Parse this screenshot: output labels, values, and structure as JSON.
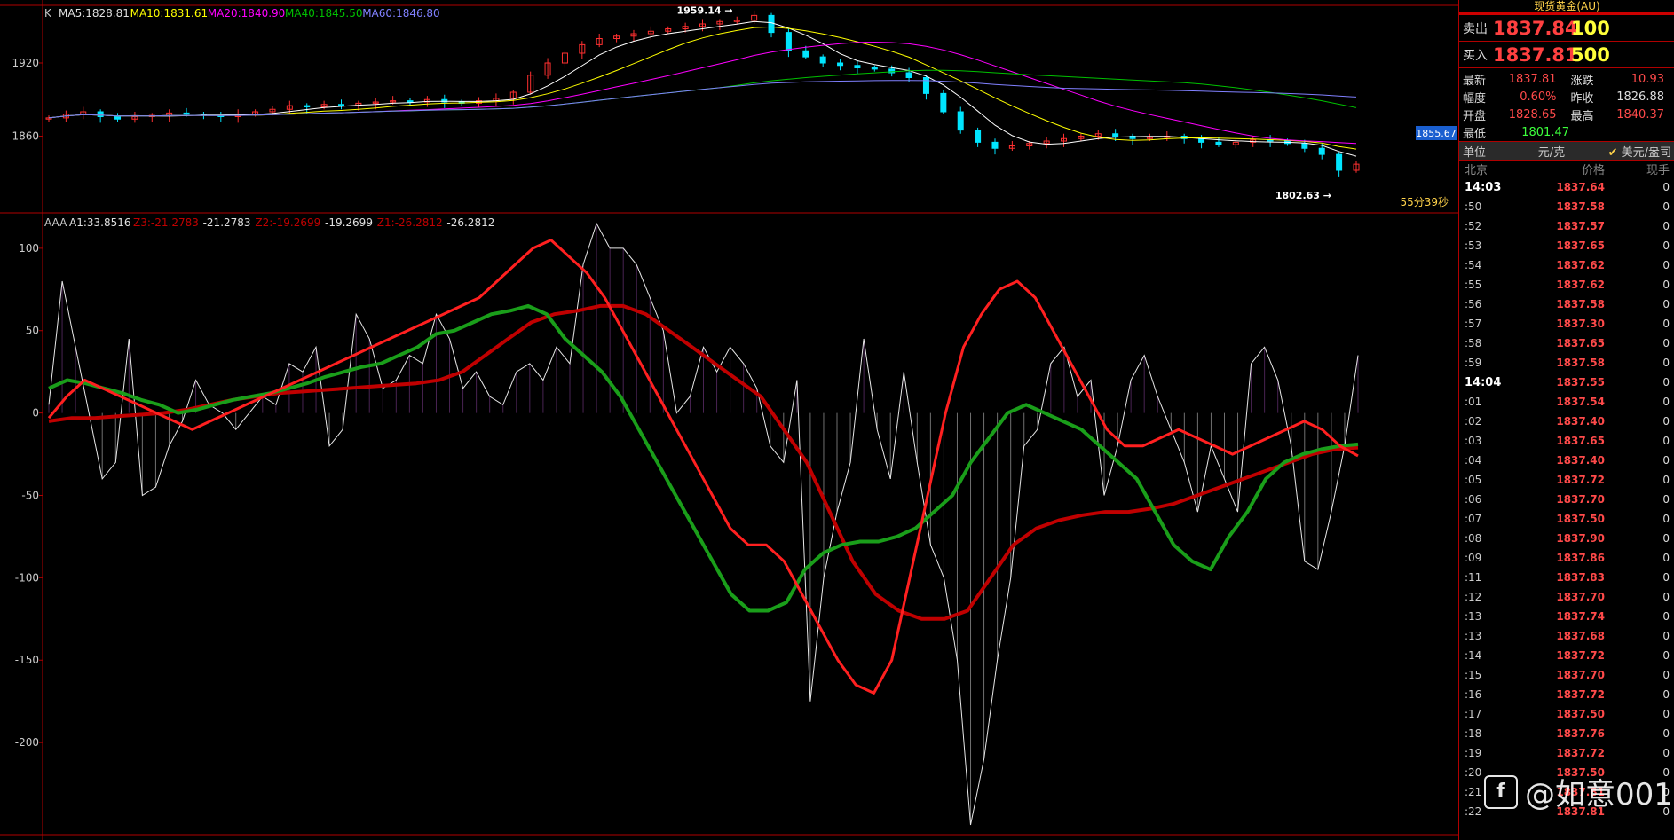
{
  "colors": {
    "up": "#ff3030",
    "down": "#00e5ff",
    "ma5": "#ffffff",
    "ma10": "#ffff00",
    "ma20": "#ff00ff",
    "ma40": "#00c000",
    "ma60": "#8080ff",
    "grid": "#b00000"
  },
  "panel_top": {
    "indicator_label": "K",
    "ma_labels": [
      {
        "text": "MA5:1828.81",
        "color": "#e0e0e0"
      },
      {
        "text": "MA10:1831.61",
        "color": "#ffff00"
      },
      {
        "text": "MA20:1840.90",
        "color": "#ff00ff"
      },
      {
        "text": "MA40:1845.50",
        "color": "#00c000"
      },
      {
        "text": "MA60:1846.80",
        "color": "#8080ff"
      }
    ],
    "high_marker": "1959.14",
    "low_marker": "1802.63",
    "current_price_tag": "1855.67",
    "countdown": "55分39秒",
    "yticks": [
      "1920",
      "1860"
    ]
  },
  "panel_bottom": {
    "indicator_label": "AAA",
    "readouts": [
      {
        "text": "A1:33.8516",
        "color": "#e0e0e0"
      },
      {
        "text": "Z3:-21.2783",
        "color": "#c00000"
      },
      {
        "text": "-21.2783",
        "color": "#e0e0e0"
      },
      {
        "text": "Z2:-19.2699",
        "color": "#c00000"
      },
      {
        "text": "-19.2699",
        "color": "#e0e0e0"
      },
      {
        "text": "Z1:-26.2812",
        "color": "#c00000"
      },
      {
        "text": "-26.2812",
        "color": "#e0e0e0"
      }
    ],
    "yticks": [
      "100",
      "50",
      "0",
      "-50",
      "-100",
      "-150",
      "-200"
    ]
  },
  "chart_data": {
    "type": "line",
    "top_price_range": [
      1800,
      1960
    ],
    "candles_approx_close": [
      1875,
      1878,
      1880,
      1876,
      1874,
      1876,
      1877,
      1879,
      1878,
      1877,
      1876,
      1878,
      1880,
      1882,
      1885,
      1884,
      1886,
      1885,
      1887,
      1888,
      1889,
      1888,
      1890,
      1888,
      1887,
      1889,
      1891,
      1896,
      1910,
      1920,
      1928,
      1935,
      1940,
      1942,
      1944,
      1946,
      1948,
      1950,
      1952,
      1954,
      1955,
      1959,
      1945,
      1930,
      1925,
      1920,
      1918,
      1916,
      1915,
      1912,
      1908,
      1895,
      1880,
      1865,
      1855,
      1850,
      1852,
      1854,
      1856,
      1858,
      1860,
      1862,
      1860,
      1858,
      1859,
      1860,
      1858,
      1855,
      1853,
      1855,
      1857,
      1856,
      1854,
      1850,
      1845,
      1832,
      1837
    ],
    "oscillator_range": [
      -250,
      115
    ],
    "A1": [
      5,
      80,
      40,
      0,
      -40,
      -30,
      45,
      -50,
      -45,
      -20,
      -5,
      20,
      5,
      0,
      -10,
      0,
      10,
      5,
      30,
      25,
      40,
      -20,
      -10,
      60,
      45,
      15,
      20,
      35,
      30,
      60,
      45,
      15,
      25,
      10,
      5,
      25,
      30,
      20,
      40,
      30,
      90,
      115,
      100,
      100,
      90,
      70,
      50,
      0,
      10,
      40,
      25,
      40,
      30,
      15,
      -20,
      -30,
      20,
      -175,
      -100,
      -60,
      -30,
      45,
      -10,
      -40,
      25,
      -30,
      -80,
      -100,
      -150,
      -250,
      -210,
      -150,
      -100,
      -20,
      -10,
      30,
      40,
      10,
      20,
      -50,
      -20,
      20,
      35,
      10,
      -10,
      -30,
      -60,
      -20,
      -40,
      -60,
      30,
      40,
      20,
      -20,
      -90,
      -95,
      -60,
      -20,
      35
    ],
    "Z1": [
      -3,
      10,
      20,
      15,
      10,
      5,
      0,
      -5,
      -10,
      -5,
      0,
      5,
      10,
      15,
      20,
      25,
      30,
      35,
      40,
      45,
      50,
      55,
      60,
      65,
      70,
      80,
      90,
      100,
      105,
      95,
      85,
      70,
      50,
      30,
      10,
      -10,
      -30,
      -50,
      -70,
      -80,
      -80,
      -90,
      -110,
      -130,
      -150,
      -165,
      -170,
      -150,
      -100,
      -50,
      0,
      40,
      60,
      75,
      80,
      70,
      50,
      30,
      10,
      -10,
      -20,
      -20,
      -15,
      -10,
      -15,
      -20,
      -25,
      -20,
      -15,
      -10,
      -5,
      -10,
      -20,
      -26
    ],
    "Z2": [
      15,
      20,
      18,
      15,
      12,
      8,
      5,
      0,
      2,
      5,
      8,
      10,
      12,
      15,
      18,
      22,
      25,
      28,
      30,
      35,
      40,
      48,
      50,
      55,
      60,
      62,
      65,
      60,
      45,
      35,
      25,
      10,
      -10,
      -30,
      -50,
      -70,
      -90,
      -110,
      -120,
      -120,
      -115,
      -95,
      -85,
      -80,
      -78,
      -78,
      -75,
      -70,
      -60,
      -50,
      -30,
      -15,
      0,
      5,
      0,
      -5,
      -10,
      -20,
      -30,
      -40,
      -60,
      -80,
      -90,
      -95,
      -75,
      -60,
      -40,
      -30,
      -25,
      -22,
      -20,
      -19
    ],
    "Z3": [
      -5,
      -3,
      -3,
      -2,
      -1,
      0,
      2,
      5,
      8,
      10,
      12,
      13,
      14,
      15,
      16,
      17,
      18,
      20,
      25,
      35,
      45,
      55,
      60,
      62,
      65,
      65,
      60,
      50,
      40,
      30,
      20,
      10,
      -10,
      -30,
      -60,
      -90,
      -110,
      -120,
      -125,
      -125,
      -120,
      -100,
      -80,
      -70,
      -65,
      -62,
      -60,
      -60,
      -58,
      -55,
      -50,
      -45,
      -40,
      -35,
      -30,
      -25,
      -22,
      -21
    ]
  },
  "sidebar": {
    "title": "现货黄金(AU)",
    "sell": {
      "label": "卖出",
      "price": "1837.84",
      "vol": "100"
    },
    "buy": {
      "label": "买入",
      "price": "1837.81",
      "vol": "500"
    },
    "stats": [
      [
        {
          "k": "最新",
          "v": "1837.81",
          "c": "#ff4a4a"
        },
        {
          "k": "涨跌",
          "v": "10.93",
          "c": "#ff4a4a"
        }
      ],
      [
        {
          "k": "幅度",
          "v": "0.60%",
          "c": "#ff4a4a"
        },
        {
          "k": "昨收",
          "v": "1826.88",
          "c": "#ddd"
        }
      ],
      [
        {
          "k": "开盘",
          "v": "1828.65",
          "c": "#ff4a4a"
        },
        {
          "k": "最高",
          "v": "1840.37",
          "c": "#ff4a4a"
        }
      ],
      [
        {
          "k": "最低",
          "v": "1801.47",
          "c": "#3cff3c"
        }
      ]
    ],
    "unit": {
      "label": "单位",
      "unit1": "元/克",
      "unit2": "美元/盎司"
    },
    "tick_header": {
      "time": "北京",
      "price": "价格",
      "vol": "现手"
    },
    "ticks": [
      {
        "t": "14:03",
        "p": "1837.64",
        "v": "0",
        "strong": true
      },
      {
        "t": ":50",
        "p": "1837.58",
        "v": "0"
      },
      {
        "t": ":52",
        "p": "1837.57",
        "v": "0"
      },
      {
        "t": ":53",
        "p": "1837.65",
        "v": "0"
      },
      {
        "t": ":54",
        "p": "1837.62",
        "v": "0"
      },
      {
        "t": ":55",
        "p": "1837.62",
        "v": "0"
      },
      {
        "t": ":56",
        "p": "1837.58",
        "v": "0"
      },
      {
        "t": ":57",
        "p": "1837.30",
        "v": "0"
      },
      {
        "t": ":58",
        "p": "1837.65",
        "v": "0"
      },
      {
        "t": ":59",
        "p": "1837.58",
        "v": "0"
      },
      {
        "t": "14:04",
        "p": "1837.55",
        "v": "0",
        "strong": true
      },
      {
        "t": ":01",
        "p": "1837.54",
        "v": "0"
      },
      {
        "t": ":02",
        "p": "1837.40",
        "v": "0"
      },
      {
        "t": ":03",
        "p": "1837.65",
        "v": "0"
      },
      {
        "t": ":04",
        "p": "1837.40",
        "v": "0"
      },
      {
        "t": ":05",
        "p": "1837.72",
        "v": "0"
      },
      {
        "t": ":06",
        "p": "1837.70",
        "v": "0"
      },
      {
        "t": ":07",
        "p": "1837.50",
        "v": "0"
      },
      {
        "t": ":08",
        "p": "1837.90",
        "v": "0"
      },
      {
        "t": ":09",
        "p": "1837.86",
        "v": "0"
      },
      {
        "t": ":11",
        "p": "1837.83",
        "v": "0"
      },
      {
        "t": ":12",
        "p": "1837.70",
        "v": "0"
      },
      {
        "t": ":13",
        "p": "1837.74",
        "v": "0"
      },
      {
        "t": ":13",
        "p": "1837.68",
        "v": "0"
      },
      {
        "t": ":14",
        "p": "1837.72",
        "v": "0"
      },
      {
        "t": ":15",
        "p": "1837.70",
        "v": "0"
      },
      {
        "t": ":16",
        "p": "1837.72",
        "v": "0"
      },
      {
        "t": ":17",
        "p": "1837.50",
        "v": "0"
      },
      {
        "t": ":18",
        "p": "1837.76",
        "v": "0"
      },
      {
        "t": ":19",
        "p": "1837.72",
        "v": "0"
      },
      {
        "t": ":20",
        "p": "1837.50",
        "v": "0"
      },
      {
        "t": ":21",
        "p": "1837.81",
        "v": "0"
      },
      {
        "t": ":22",
        "p": "1837.81",
        "v": "0"
      }
    ]
  },
  "watermark": "@如意001"
}
